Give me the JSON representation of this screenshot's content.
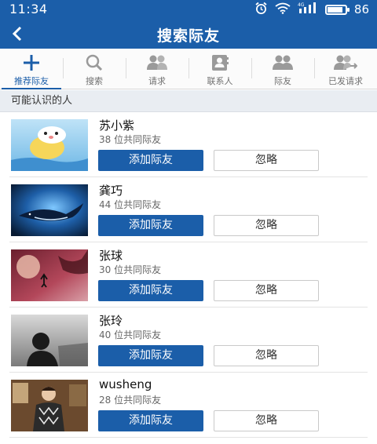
{
  "status_bar": {
    "time": "11:34",
    "network": "4G",
    "battery_percent": "86",
    "battery_level": 0.86
  },
  "header": {
    "title": "搜索际友"
  },
  "tabs": [
    {
      "label": "推荐际友",
      "icon": "plus-icon",
      "active": true
    },
    {
      "label": "搜索",
      "icon": "search-icon",
      "active": false
    },
    {
      "label": "请求",
      "icon": "people-request-icon",
      "active": false
    },
    {
      "label": "联系人",
      "icon": "contacts-icon",
      "active": false
    },
    {
      "label": "际友",
      "icon": "friends-icon",
      "active": false
    },
    {
      "label": "已发请求",
      "icon": "sent-request-icon",
      "active": false
    }
  ],
  "section": {
    "title": "可能认识的人"
  },
  "people": [
    {
      "name": "苏小紫",
      "mutual": "38 位共同际友",
      "add_label": "添加际友",
      "ignore_label": "忽略",
      "avatar": "cartoon-seal-on-balloon"
    },
    {
      "name": "龚巧",
      "mutual": "44 位共同际友",
      "add_label": "添加际友",
      "ignore_label": "忽略",
      "avatar": "whale-in-blue-swirl"
    },
    {
      "name": "张球",
      "mutual": "30 位共同际友",
      "add_label": "添加际友",
      "ignore_label": "忽略",
      "avatar": "figure-under-red-moon"
    },
    {
      "name": "张玲",
      "mutual": "40 位共同际友",
      "add_label": "添加际友",
      "ignore_label": "忽略",
      "avatar": "person-silhouette-grey"
    },
    {
      "name": "wusheng",
      "mutual": "28 位共同际友",
      "add_label": "添加际友",
      "ignore_label": "忽略",
      "avatar": "person-argyle-sweater"
    }
  ],
  "colors": {
    "primary": "#1b5ea9",
    "section_bg": "#e9edf2"
  }
}
